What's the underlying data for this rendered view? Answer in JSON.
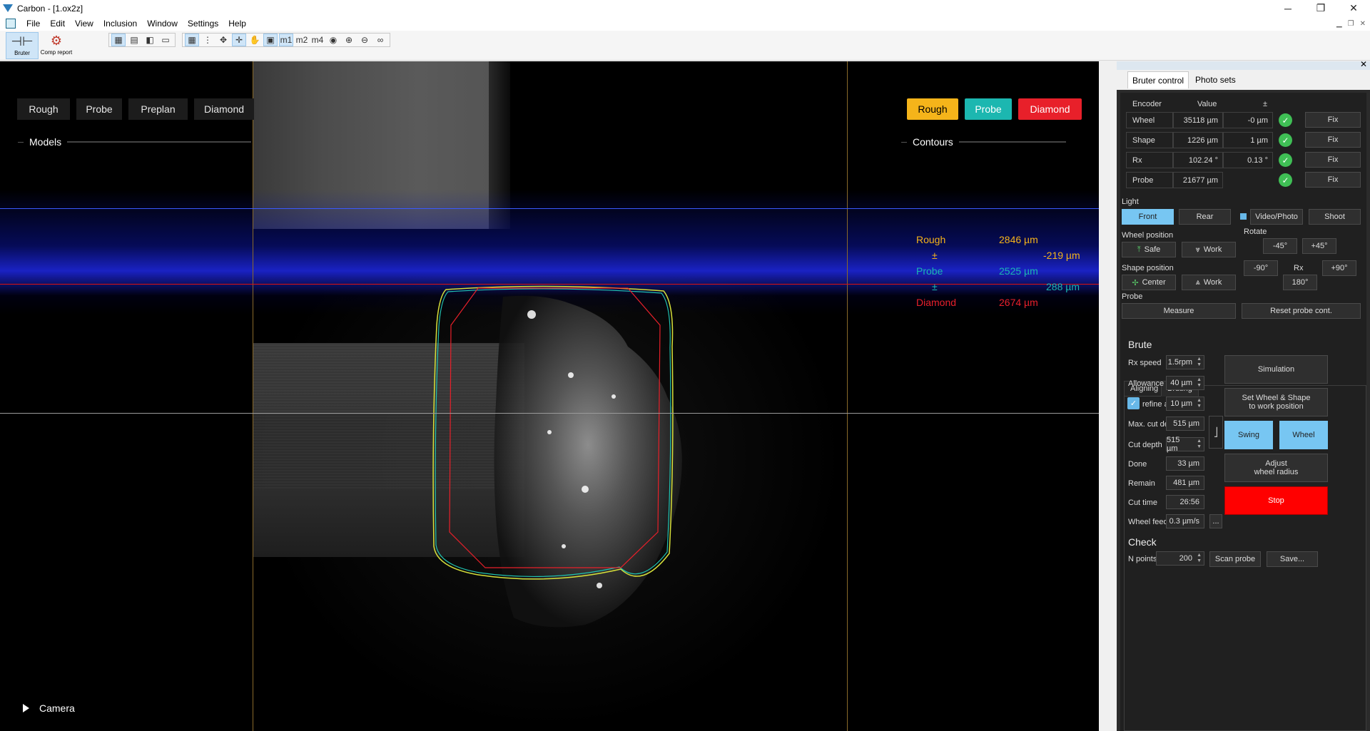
{
  "window": {
    "title": "Carbon - [1.ox2z]",
    "controls": [
      "─",
      "❐",
      "✕"
    ]
  },
  "menu": {
    "items": [
      "File",
      "Edit",
      "View",
      "Inclusion",
      "Window",
      "Settings",
      "Help"
    ]
  },
  "toolbar": {
    "bruter_label": "Bruter",
    "report_label": "Comp report",
    "m_labels": [
      "m1",
      "m2",
      "m4"
    ]
  },
  "viewport": {
    "models_title": "Models",
    "models": [
      "Rough",
      "Probe",
      "Preplan",
      "Diamond"
    ],
    "contours_title": "Contours",
    "contours": [
      {
        "label": "Rough",
        "color": "#f5b41a"
      },
      {
        "label": "Probe",
        "color": "#1cb7b0"
      },
      {
        "label": "Diamond",
        "color": "#e8202a"
      }
    ],
    "measurements": {
      "rough_label": "Rough",
      "rough_value": "2846 µm",
      "pm1": "±",
      "delta1": "-219 µm",
      "probe_label": "Probe",
      "probe_value": "2525 µm",
      "pm2": "±",
      "delta2": "288 µm",
      "diamond_label": "Diamond",
      "diamond_value": "2674 µm"
    },
    "camera_label": "Camera"
  },
  "panel": {
    "tabs": [
      "Bruter control",
      "Photo sets"
    ],
    "encoder_header": {
      "encoder": "Encoder",
      "value": "Value",
      "pm": "±"
    },
    "encoders": [
      {
        "name": "Wheel",
        "value": "35118 µm",
        "delta": "-0 µm",
        "fix": "Fix"
      },
      {
        "name": "Shape",
        "value": "1226 µm",
        "delta": "1 µm",
        "fix": "Fix"
      },
      {
        "name": "Rx",
        "value": "102.24 °",
        "delta": "0.13 °",
        "fix": "Fix"
      },
      {
        "name": "Probe",
        "value": "21677 µm",
        "delta": "",
        "fix": "Fix"
      }
    ],
    "light_label": "Light",
    "light_front": "Front",
    "light_rear": "Rear",
    "video_photo": "Video/Photo",
    "shoot": "Shoot",
    "wheel_position_label": "Wheel position",
    "rotate_label": "Rotate",
    "wheel_safe": "Safe",
    "wheel_work": "Work",
    "rot_m45": "-45°",
    "rot_p45": "+45°",
    "shape_position_label": "Shape position",
    "rot_m90": "-90°",
    "rx_label": "Rx",
    "rot_p90": "+90°",
    "shape_center": "Center",
    "shape_work": "Work",
    "rot_180": "180°",
    "probe_label": "Probe",
    "measure": "Measure",
    "reset_probe": "Reset probe cont.",
    "subtabs": [
      "Aligning",
      "Bruting"
    ],
    "brute_title": "Brute",
    "rx_speed_label": "Rx speed",
    "rx_speed": "1.5rpm",
    "allowance_label": "Allowance",
    "allowance": "40 µm",
    "refine_label": "refine a",
    "refine": "10 µm",
    "max_cut_label": "Max. cut de",
    "max_cut": "515 µm",
    "cut_depth_label": "Cut depth",
    "cut_depth": "515 µm",
    "done_label": "Done",
    "done": "33 µm",
    "remain_label": "Remain",
    "remain": "481 µm",
    "cut_time_label": "Cut time",
    "cut_time": "26:56",
    "wheel_feed_label": "Wheel feed",
    "wheel_feed": "0.3 µm/s",
    "more": "...",
    "simulation": "Simulation",
    "set_wheel_shape_1": "Set Wheel & Shape",
    "set_wheel_shape_2": "to work position",
    "swing": "Swing",
    "wheel": "Wheel",
    "adjust_1": "Adjust",
    "adjust_2": "wheel radius",
    "stop": "Stop",
    "check_title": "Check",
    "npoints_label": "N points",
    "npoints": "200",
    "scan_probe": "Scan probe",
    "save": "Save..."
  }
}
